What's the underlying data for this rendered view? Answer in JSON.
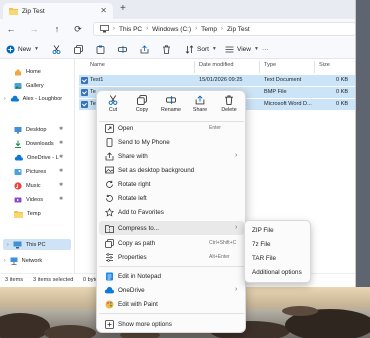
{
  "window": {
    "tab_title": "Zip Test",
    "close_glyph": "✕",
    "newtab_glyph": "+"
  },
  "nav": {
    "back": "←",
    "forward": "→",
    "up": "↑",
    "refresh": "⟳"
  },
  "breadcrumb": [
    "This PC",
    "Windows (C:)",
    "Temp",
    "Zip Test"
  ],
  "breadcrumb_sep": "›",
  "toolbar": {
    "new_label": "New",
    "sort_label": "Sort",
    "view_label": "View",
    "more_label": "···"
  },
  "sidebar": {
    "items": [
      "Home",
      "Gallery",
      "Alex - Loughbor",
      "Desktop",
      "Downloads",
      "OneDrive - L",
      "Pictures",
      "Music",
      "Videos",
      "Temp",
      "This PC",
      "Network"
    ]
  },
  "columns": {
    "name": "Name",
    "date": "Date modified",
    "type": "Type",
    "size": "Size"
  },
  "files": [
    {
      "name": "Test1",
      "date": "15/01/2026 09:25",
      "type": "Text Document",
      "size": "0 KB"
    },
    {
      "name": "Te",
      "date": "",
      "type": "BMP File",
      "size": "0 KB"
    },
    {
      "name": "Te",
      "date": "",
      "type": "Microsoft Word D...",
      "size": "0 KB"
    }
  ],
  "status": {
    "items": "3 items",
    "selected": "3 items selected",
    "size": "0 bytes"
  },
  "context_menu": {
    "quick_actions": [
      "Cut",
      "Copy",
      "Rename",
      "Share",
      "Delete"
    ],
    "items": [
      {
        "label": "Open",
        "shortcut": "Enter",
        "arrow": ""
      },
      {
        "label": "Send to My Phone",
        "shortcut": "",
        "arrow": ""
      },
      {
        "label": "Share with",
        "shortcut": "",
        "arrow": "›"
      },
      {
        "label": "Set as desktop background",
        "shortcut": "",
        "arrow": ""
      },
      {
        "label": "Rotate right",
        "shortcut": "",
        "arrow": ""
      },
      {
        "label": "Rotate left",
        "shortcut": "",
        "arrow": ""
      },
      {
        "label": "Add to Favorites",
        "shortcut": "",
        "arrow": ""
      },
      {
        "label": "Compress to...",
        "shortcut": "",
        "arrow": "›"
      },
      {
        "label": "Copy as path",
        "shortcut": "Ctrl+Shift+C",
        "arrow": ""
      },
      {
        "label": "Properties",
        "shortcut": "Alt+Enter",
        "arrow": ""
      },
      {
        "label": "Edit in Notepad",
        "shortcut": "",
        "arrow": ""
      },
      {
        "label": "OneDrive",
        "shortcut": "",
        "arrow": "›"
      },
      {
        "label": "Edit with Paint",
        "shortcut": "",
        "arrow": ""
      },
      {
        "label": "Show more options",
        "shortcut": "",
        "arrow": ""
      }
    ]
  },
  "compress_submenu": [
    "ZIP File",
    "7z File",
    "TAR File",
    "Additional options"
  ],
  "colors": {
    "selection": "#cce4f7",
    "accent": "#0067c0",
    "menu_bg": "#fbfbfb"
  }
}
